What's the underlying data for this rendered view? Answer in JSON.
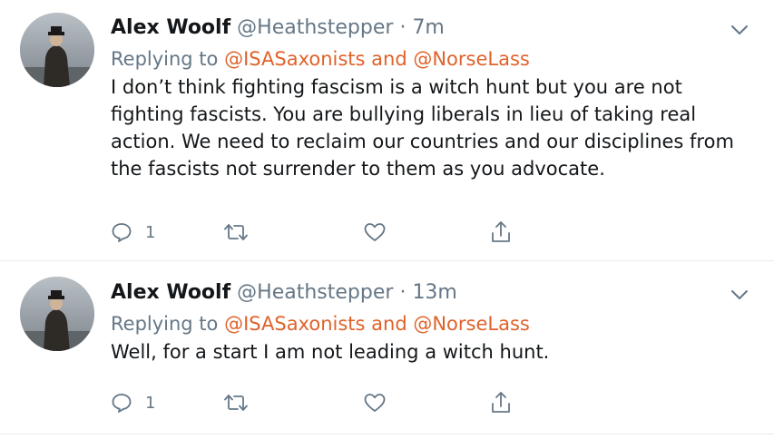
{
  "tweets": [
    {
      "name": "Alex Woolf",
      "handle": "@Heathstepper",
      "separator": "·",
      "time": "7m",
      "replying_prefix": "Replying to",
      "replying_to": "@ISASaxonists and @NorseLass",
      "text": "I don’t think fighting fascism is a witch hunt but you are not fighting fascists. You are bullying liberals in lieu of taking real action. We need to reclaim our countries and our disciplines from the fascists not surrender to them as you advocate.",
      "reply_count": "1"
    },
    {
      "name": "Alex Woolf",
      "handle": "@Heathstepper",
      "separator": "·",
      "time": "13m",
      "replying_prefix": "Replying to",
      "replying_to": "@ISASaxonists and @NorseLass",
      "text": "Well, for a start I am not leading a witch hunt.",
      "reply_count": "1"
    }
  ],
  "icons": {
    "reply": "reply-icon",
    "retweet": "retweet-icon",
    "like": "heart-icon",
    "share": "share-icon",
    "more": "chevron-down-icon"
  },
  "colors": {
    "mention": "#e0622a",
    "secondary_text": "#657786",
    "divider": "#e6ecf0"
  }
}
